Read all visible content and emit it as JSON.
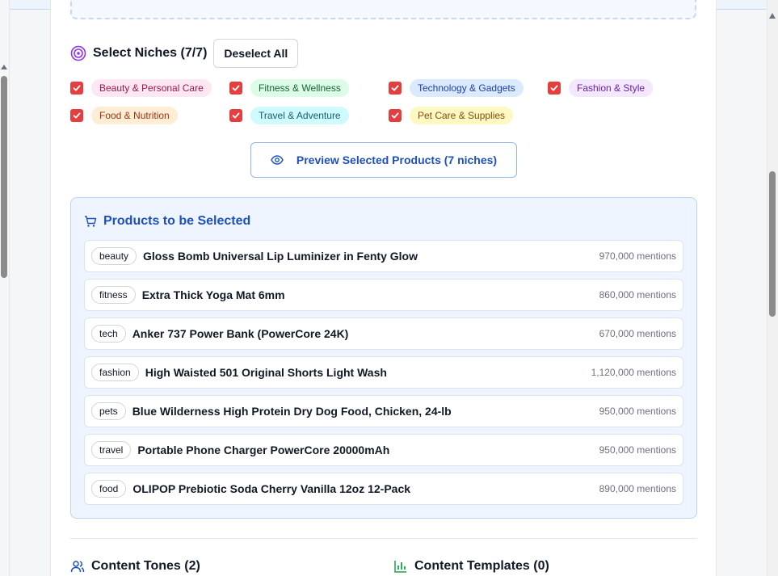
{
  "niches": {
    "title": "Select Niches (7/7)",
    "deselect_label": "Deselect All",
    "items": [
      {
        "label": "Beauty & Personal Care",
        "bg": "#fce7f3",
        "fg": "#9d174d"
      },
      {
        "label": "Fitness & Wellness",
        "bg": "#dcfce7",
        "fg": "#166534"
      },
      {
        "label": "Technology & Gadgets",
        "bg": "#dbeafe",
        "fg": "#1e40af"
      },
      {
        "label": "Fashion & Style",
        "bg": "#f3e8ff",
        "fg": "#6b21a8"
      },
      {
        "label": "Food & Nutrition",
        "bg": "#ffedd5",
        "fg": "#9a3412"
      },
      {
        "label": "Travel & Adventure",
        "bg": "#cffafe",
        "fg": "#155e75"
      },
      {
        "label": "Pet Care & Supplies",
        "bg": "#fef9c3",
        "fg": "#854d0e"
      }
    ]
  },
  "preview": {
    "label": "Preview Selected Products (7 niches)"
  },
  "products": {
    "title": "Products to be Selected",
    "rows": [
      {
        "tag": "beauty",
        "name": "Gloss Bomb Universal Lip Luminizer in Fenty Glow",
        "mentions": "970,000 mentions"
      },
      {
        "tag": "fitness",
        "name": "Extra Thick Yoga Mat 6mm",
        "mentions": "860,000 mentions"
      },
      {
        "tag": "tech",
        "name": "Anker 737 Power Bank (PowerCore 24K)",
        "mentions": "670,000 mentions"
      },
      {
        "tag": "fashion",
        "name": "High Waisted 501 Original Shorts Light Wash",
        "mentions": "1,120,000 mentions"
      },
      {
        "tag": "pets",
        "name": "Blue Wilderness High Protein Dry Dog Food, Chicken, 24-lb",
        "mentions": "950,000 mentions"
      },
      {
        "tag": "travel",
        "name": "Portable Phone Charger PowerCore 20000mAh",
        "mentions": "950,000 mentions"
      },
      {
        "tag": "food",
        "name": "OLIPOP Prebiotic Soda Cherry Vanilla 12oz 12-Pack",
        "mentions": "890,000 mentions"
      }
    ]
  },
  "sections": {
    "tones_title": "Content Tones (2)",
    "templates_title": "Content Templates (0)"
  },
  "colors": {
    "accent": "#1e4fbf",
    "checkbox": "#e53e3e",
    "target_icon": "#9333ea"
  }
}
